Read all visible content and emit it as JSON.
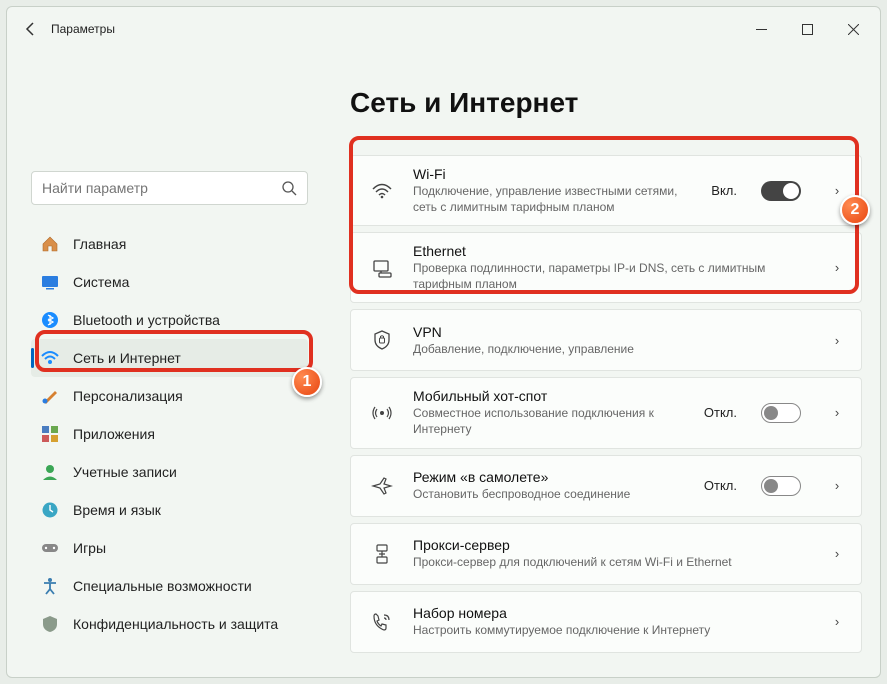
{
  "window": {
    "title": "Параметры"
  },
  "search": {
    "placeholder": "Найти параметр"
  },
  "sidebar": {
    "items": [
      {
        "label": "Главная"
      },
      {
        "label": "Система"
      },
      {
        "label": "Bluetooth и устройства"
      },
      {
        "label": "Сеть и Интернет"
      },
      {
        "label": "Персонализация"
      },
      {
        "label": "Приложения"
      },
      {
        "label": "Учетные записи"
      },
      {
        "label": "Время и язык"
      },
      {
        "label": "Игры"
      },
      {
        "label": "Специальные возможности"
      },
      {
        "label": "Конфиденциальность и защита"
      }
    ]
  },
  "main": {
    "title": "Сеть и Интернет",
    "cards": [
      {
        "title": "Wi-Fi",
        "desc": "Подключение, управление известными сетями, сеть с лимитным тарифным планом",
        "status": "Вкл.",
        "toggle": "on"
      },
      {
        "title": "Ethernet",
        "desc": "Проверка подлинности, параметры IP-и DNS, сеть с лимитным тарифным планом"
      },
      {
        "title": "VPN",
        "desc": "Добавление, подключение, управление"
      },
      {
        "title": "Мобильный хот-спот",
        "desc": "Совместное использование подключения к Интернету",
        "status": "Откл.",
        "toggle": "off"
      },
      {
        "title": "Режим «в самолете»",
        "desc": "Остановить беспроводное соединение",
        "status": "Откл.",
        "toggle": "off"
      },
      {
        "title": "Прокси-сервер",
        "desc": "Прокси-сервер для подключений к сетям Wi-Fi и Ethernet"
      },
      {
        "title": "Набор номера",
        "desc": "Настроить коммутируемое подключение к Интернету"
      }
    ]
  },
  "markers": {
    "1": "1",
    "2": "2"
  }
}
